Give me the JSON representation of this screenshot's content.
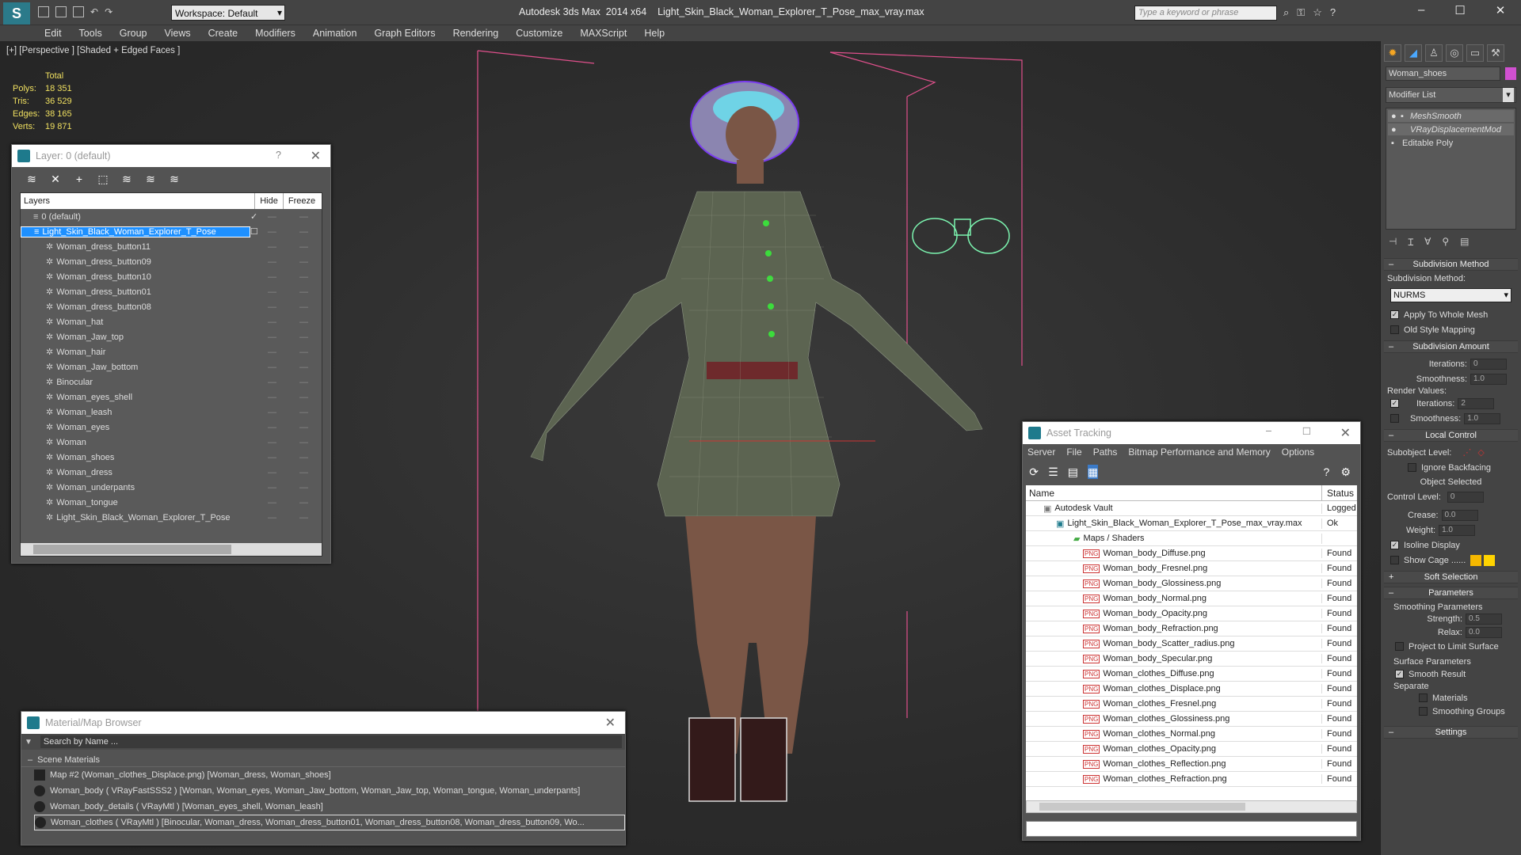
{
  "app": {
    "title": "Autodesk 3ds Max  2014 x64    Light_Skin_Black_Woman_Explorer_T_Pose_max_vray.max",
    "workspace": "Workspace: Default",
    "search_placeholder": "Type a keyword or phrase",
    "menu": [
      "Edit",
      "Tools",
      "Group",
      "Views",
      "Create",
      "Modifiers",
      "Animation",
      "Graph Editors",
      "Rendering",
      "Customize",
      "MAXScript",
      "Help"
    ]
  },
  "viewport": {
    "label": "[+] [Perspective ] [Shaded + Edged Faces ]",
    "stats": {
      "header": "Total",
      "rows": [
        {
          "k": "Polys:",
          "v": "18 351"
        },
        {
          "k": "Tris:",
          "v": "36 529"
        },
        {
          "k": "Edges:",
          "v": "38 165"
        },
        {
          "k": "Verts:",
          "v": "19 871"
        }
      ]
    }
  },
  "layer_panel": {
    "title": "Layer: 0 (default)",
    "help": "?",
    "col_layers": "Layers",
    "col_hide": "Hide",
    "col_freeze": "Freeze",
    "root": "0 (default)",
    "selected": "Light_Skin_Black_Woman_Explorer_T_Pose",
    "items": [
      "Woman_dress_button11",
      "Woman_dress_button09",
      "Woman_dress_button10",
      "Woman_dress_button01",
      "Woman_dress_button08",
      "Woman_hat",
      "Woman_Jaw_top",
      "Woman_hair",
      "Woman_Jaw_bottom",
      "Binocular",
      "Woman_eyes_shell",
      "Woman_leash",
      "Woman_eyes",
      "Woman",
      "Woman_shoes",
      "Woman_dress",
      "Woman_underpants",
      "Woman_tongue",
      "Light_Skin_Black_Woman_Explorer_T_Pose"
    ]
  },
  "asset_panel": {
    "title": "Asset Tracking",
    "menu": [
      "Server",
      "File",
      "Paths",
      "Bitmap Performance and Memory",
      "Options"
    ],
    "col_name": "Name",
    "col_status": "Status",
    "vault": {
      "name": "Autodesk Vault",
      "status": "Logged"
    },
    "file": {
      "name": "Light_Skin_Black_Woman_Explorer_T_Pose_max_vray.max",
      "status": "Ok"
    },
    "group": "Maps / Shaders",
    "maps": [
      {
        "name": "Woman_body_Diffuse.png",
        "status": "Found"
      },
      {
        "name": "Woman_body_Fresnel.png",
        "status": "Found"
      },
      {
        "name": "Woman_body_Glossiness.png",
        "status": "Found"
      },
      {
        "name": "Woman_body_Normal.png",
        "status": "Found"
      },
      {
        "name": "Woman_body_Opacity.png",
        "status": "Found"
      },
      {
        "name": "Woman_body_Refraction.png",
        "status": "Found"
      },
      {
        "name": "Woman_body_Scatter_radius.png",
        "status": "Found"
      },
      {
        "name": "Woman_body_Specular.png",
        "status": "Found"
      },
      {
        "name": "Woman_clothes_Diffuse.png",
        "status": "Found"
      },
      {
        "name": "Woman_clothes_Displace.png",
        "status": "Found"
      },
      {
        "name": "Woman_clothes_Fresnel.png",
        "status": "Found"
      },
      {
        "name": "Woman_clothes_Glossiness.png",
        "status": "Found"
      },
      {
        "name": "Woman_clothes_Normal.png",
        "status": "Found"
      },
      {
        "name": "Woman_clothes_Opacity.png",
        "status": "Found"
      },
      {
        "name": "Woman_clothes_Reflection.png",
        "status": "Found"
      },
      {
        "name": "Woman_clothes_Refraction.png",
        "status": "Found"
      }
    ]
  },
  "material_panel": {
    "title": "Material/Map Browser",
    "search_placeholder": "Search by Name ...",
    "section": "Scene Materials",
    "items": [
      "Map #2 (Woman_clothes_Displace.png) [Woman_dress, Woman_shoes]",
      "Woman_body  ( VRayFastSSS2 ) [Woman, Woman_eyes, Woman_Jaw_bottom, Woman_Jaw_top, Woman_tongue, Woman_underpants]",
      "Woman_body_details  ( VRayMtl ) [Woman_eyes_shell, Woman_leash]",
      "Woman_clothes  ( VRayMtl ) [Binocular, Woman_dress, Woman_dress_button01, Woman_dress_button08, Woman_dress_button09, Wo..."
    ]
  },
  "command_panel": {
    "object_name": "Woman_shoes",
    "modifier_list": "Modifier List",
    "stack": [
      "MeshSmooth",
      "VRayDisplacementMod",
      "Editable Poly"
    ],
    "subdiv_method_title": "Subdivision Method",
    "subdiv_method_label": "Subdivision Method:",
    "subdiv_method_value": "NURMS",
    "apply_whole": "Apply To Whole Mesh",
    "old_style": "Old Style Mapping",
    "subdiv_amount_title": "Subdivision Amount",
    "iterations_label": "Iterations:",
    "iterations_value": "0",
    "smoothness_label": "Smoothness:",
    "smoothness_value": "1.0",
    "render_values": "Render Values:",
    "r_iterations_label": "Iterations:",
    "r_iterations_value": "2",
    "r_smoothness_label": "Smoothness:",
    "r_smoothness_value": "1.0",
    "local_control_title": "Local Control",
    "subobject_label": "Subobject Level:",
    "ignore_backfacing": "Ignore Backfacing",
    "object_selected": "Object Selected",
    "control_level_label": "Control Level:",
    "control_level_value": "0",
    "crease_label": "Crease:",
    "crease_value": "0.0",
    "weight_label": "Weight:",
    "weight_value": "1.0",
    "isoline": "Isoline Display",
    "show_cage": "Show Cage ......",
    "soft_selection_title": "Soft Selection",
    "parameters_title": "Parameters",
    "smoothing_params": "Smoothing Parameters",
    "strength_label": "Strength:",
    "strength_value": "0.5",
    "relax_label": "Relax:",
    "relax_value": "0.0",
    "project_limit": "Project to Limit Surface",
    "surface_params": "Surface Parameters",
    "smooth_result": "Smooth Result",
    "separate": "Separate",
    "materials": "Materials",
    "smoothing_groups": "Smoothing Groups",
    "settings_title": "Settings"
  },
  "colors": {
    "accent": "#1e7a8c",
    "selection": "#1e90ff",
    "wire_pink": "#e0508c",
    "binocular": "#7cf5b0"
  }
}
